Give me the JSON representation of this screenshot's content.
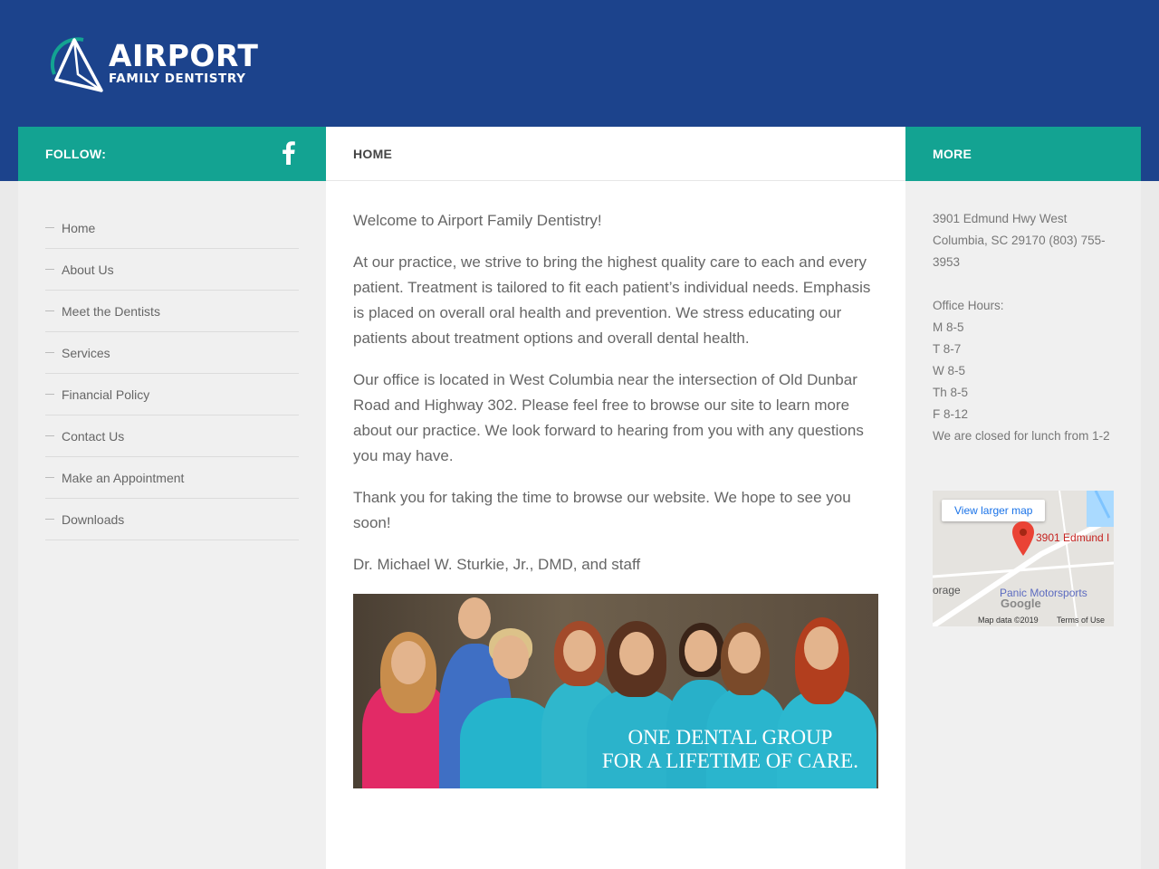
{
  "header": {
    "logo_name": "AIRPORT",
    "logo_sub": "FAMILY DENTISTRY"
  },
  "colors": {
    "brand_blue": "#1c438c",
    "teal": "#13a392"
  },
  "left_sidebar": {
    "follow_label": "FOLLOW:",
    "social_icon": "facebook-icon",
    "nav": [
      "Home",
      "About Us",
      "Meet the Dentists",
      "Services",
      "Financial Policy",
      "Contact Us",
      "Make an Appointment",
      "Downloads"
    ]
  },
  "main": {
    "title": "HOME",
    "paragraphs": [
      "Welcome to Airport Family Dentistry!",
      "At our practice, we strive to bring the highest quality care to each and every patient.  Treatment is tailored to fit each patient’s individual needs.  Emphasis is placed on overall oral health and prevention.  We stress educating our patients about treatment options and overall dental health.",
      "Our office is located in West Columbia near the intersection of Old Dunbar Road and Highway 302.  Please feel free to browse our site to learn more about our practice.  We look forward to hearing from you with any questions you may have.",
      "Thank you for taking the time to browse our website. We hope to see you soon!",
      "Dr. Michael W. Sturkie, Jr., DMD, and staff"
    ],
    "photo_caption_1": "ONE DENTAL GROUP",
    "photo_caption_2": "FOR A LIFETIME OF CARE."
  },
  "right_sidebar": {
    "title": "MORE",
    "address_1": "3901 Edmund Hwy West",
    "address_2": "Columbia, SC 29170 (803) 755-",
    "address_3": "3953",
    "hours_title": "Office Hours:",
    "hours": [
      "M 8-5",
      "T 8-7",
      "W 8-5",
      "Th 8-5",
      "F 8-12"
    ],
    "lunch_note": "We are closed for lunch from 1-2",
    "map": {
      "button": "View larger map",
      "pin_label": "3901 Edmund I",
      "label_left": "orage",
      "label_poi": "Panic Motorsports",
      "google": "Google",
      "data": "Map data ©2019",
      "terms": "Terms of Use"
    }
  }
}
